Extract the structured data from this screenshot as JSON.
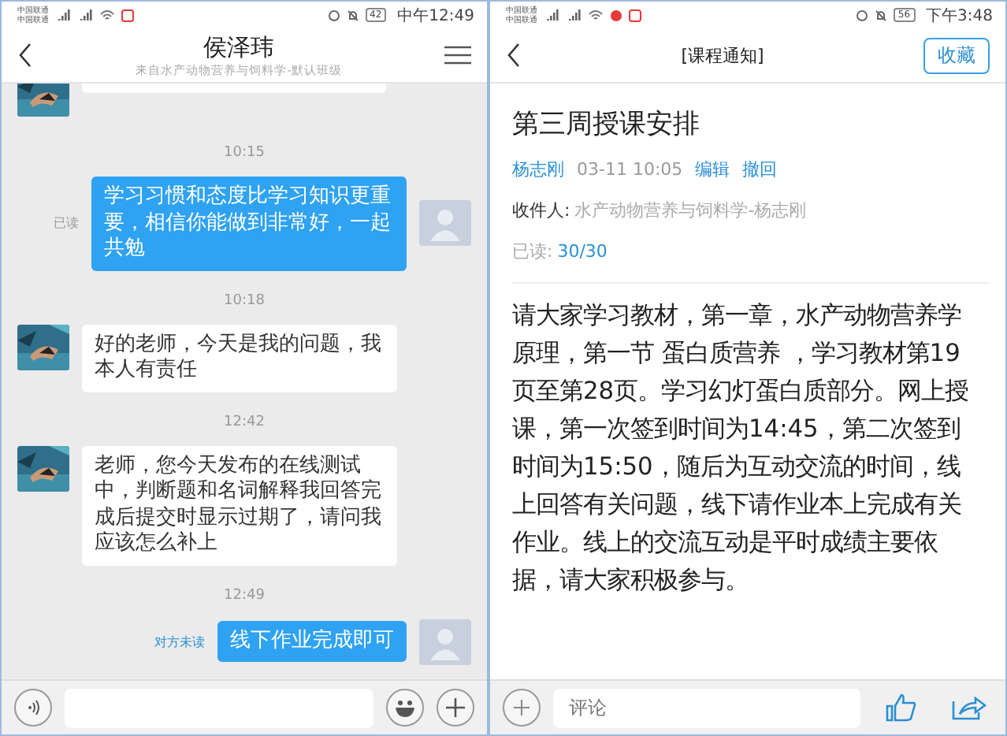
{
  "chat": {
    "status_bar": {
      "carriers": [
        "中国联通",
        "中国联通"
      ],
      "battery": "42",
      "time": "中午12:49"
    },
    "header": {
      "title": "侯泽玮",
      "subtitle": "来自水产动物营养与饲料学-默认班级"
    },
    "messages": [
      {
        "kind": "partial"
      },
      {
        "kind": "time",
        "text": "10:15"
      },
      {
        "kind": "outgoing",
        "text": "学习习惯和态度比学习知识更重要，相信你能做到非常好，一起共勉",
        "receipt": "已读",
        "read": true
      },
      {
        "kind": "time",
        "text": "10:18"
      },
      {
        "kind": "incoming",
        "text": "好的老师，今天是我的问题，我本人有责任"
      },
      {
        "kind": "time",
        "text": "12:42"
      },
      {
        "kind": "incoming",
        "text": "老师，您今天发布的在线测试中，判断题和名词解释我回答完成后提交时显示过期了，请问我应该怎么补上"
      },
      {
        "kind": "time",
        "text": "12:49"
      },
      {
        "kind": "outgoing",
        "text": "线下作业完成即可",
        "receipt": "对方未读",
        "read": false
      }
    ]
  },
  "notice": {
    "status_bar": {
      "carriers": [
        "中国联通",
        "中国联通"
      ],
      "battery": "56",
      "time": "下午3:48"
    },
    "header": {
      "title": "[课程通知]",
      "action": "收藏"
    },
    "title": "第三周授课安排",
    "author": "杨志刚",
    "date": "03-11 10:05",
    "actions": [
      "编辑",
      "撤回"
    ],
    "recipient_label": "收件人:",
    "recipient": "水产动物营养与饲料学-杨志刚",
    "read_label": "已读:",
    "read_count": "30/30",
    "body": "请大家学习教材，第一章，水产动物营养学原理，第一节 蛋白质营养 ，学习教材第19页至第28页。学习幻灯蛋白质部分。网上授课，第一次签到时间为14:45，第二次签到时间为15:50，随后为互动交流的时间，线上回答有关问题，线下请作业本上完成有关作业。线上的交流互动是平时成绩主要依据，请大家积极参与。",
    "comment": {
      "placeholder": "评论"
    }
  }
}
